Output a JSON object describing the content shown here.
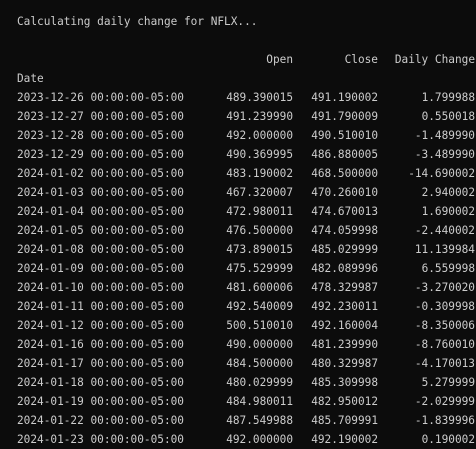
{
  "terminal": {
    "status": "Calculating daily change for NFLX...",
    "index_name": "Date",
    "columns": [
      "Open",
      "Close",
      "Daily Change"
    ],
    "rows": [
      {
        "date": "2023-12-26 00:00:00-05:00",
        "open": "489.390015",
        "close": "491.190002",
        "change": "1.799988"
      },
      {
        "date": "2023-12-27 00:00:00-05:00",
        "open": "491.239990",
        "close": "491.790009",
        "change": "0.550018"
      },
      {
        "date": "2023-12-28 00:00:00-05:00",
        "open": "492.000000",
        "close": "490.510010",
        "change": "-1.489990"
      },
      {
        "date": "2023-12-29 00:00:00-05:00",
        "open": "490.369995",
        "close": "486.880005",
        "change": "-3.489990"
      },
      {
        "date": "2024-01-02 00:00:00-05:00",
        "open": "483.190002",
        "close": "468.500000",
        "change": "-14.690002"
      },
      {
        "date": "2024-01-03 00:00:00-05:00",
        "open": "467.320007",
        "close": "470.260010",
        "change": "2.940002"
      },
      {
        "date": "2024-01-04 00:00:00-05:00",
        "open": "472.980011",
        "close": "474.670013",
        "change": "1.690002"
      },
      {
        "date": "2024-01-05 00:00:00-05:00",
        "open": "476.500000",
        "close": "474.059998",
        "change": "-2.440002"
      },
      {
        "date": "2024-01-08 00:00:00-05:00",
        "open": "473.890015",
        "close": "485.029999",
        "change": "11.139984"
      },
      {
        "date": "2024-01-09 00:00:00-05:00",
        "open": "475.529999",
        "close": "482.089996",
        "change": "6.559998"
      },
      {
        "date": "2024-01-10 00:00:00-05:00",
        "open": "481.600006",
        "close": "478.329987",
        "change": "-3.270020"
      },
      {
        "date": "2024-01-11 00:00:00-05:00",
        "open": "492.540009",
        "close": "492.230011",
        "change": "-0.309998"
      },
      {
        "date": "2024-01-12 00:00:00-05:00",
        "open": "500.510010",
        "close": "492.160004",
        "change": "-8.350006"
      },
      {
        "date": "2024-01-16 00:00:00-05:00",
        "open": "490.000000",
        "close": "481.239990",
        "change": "-8.760010"
      },
      {
        "date": "2024-01-17 00:00:00-05:00",
        "open": "484.500000",
        "close": "480.329987",
        "change": "-4.170013"
      },
      {
        "date": "2024-01-18 00:00:00-05:00",
        "open": "480.029999",
        "close": "485.309998",
        "change": "5.279999"
      },
      {
        "date": "2024-01-19 00:00:00-05:00",
        "open": "484.980011",
        "close": "482.950012",
        "change": "-2.029999"
      },
      {
        "date": "2024-01-22 00:00:00-05:00",
        "open": "487.549988",
        "close": "485.709991",
        "change": "-1.839996"
      },
      {
        "date": "2024-01-23 00:00:00-05:00",
        "open": "492.000000",
        "close": "492.190002",
        "change": "0.190002"
      }
    ]
  }
}
